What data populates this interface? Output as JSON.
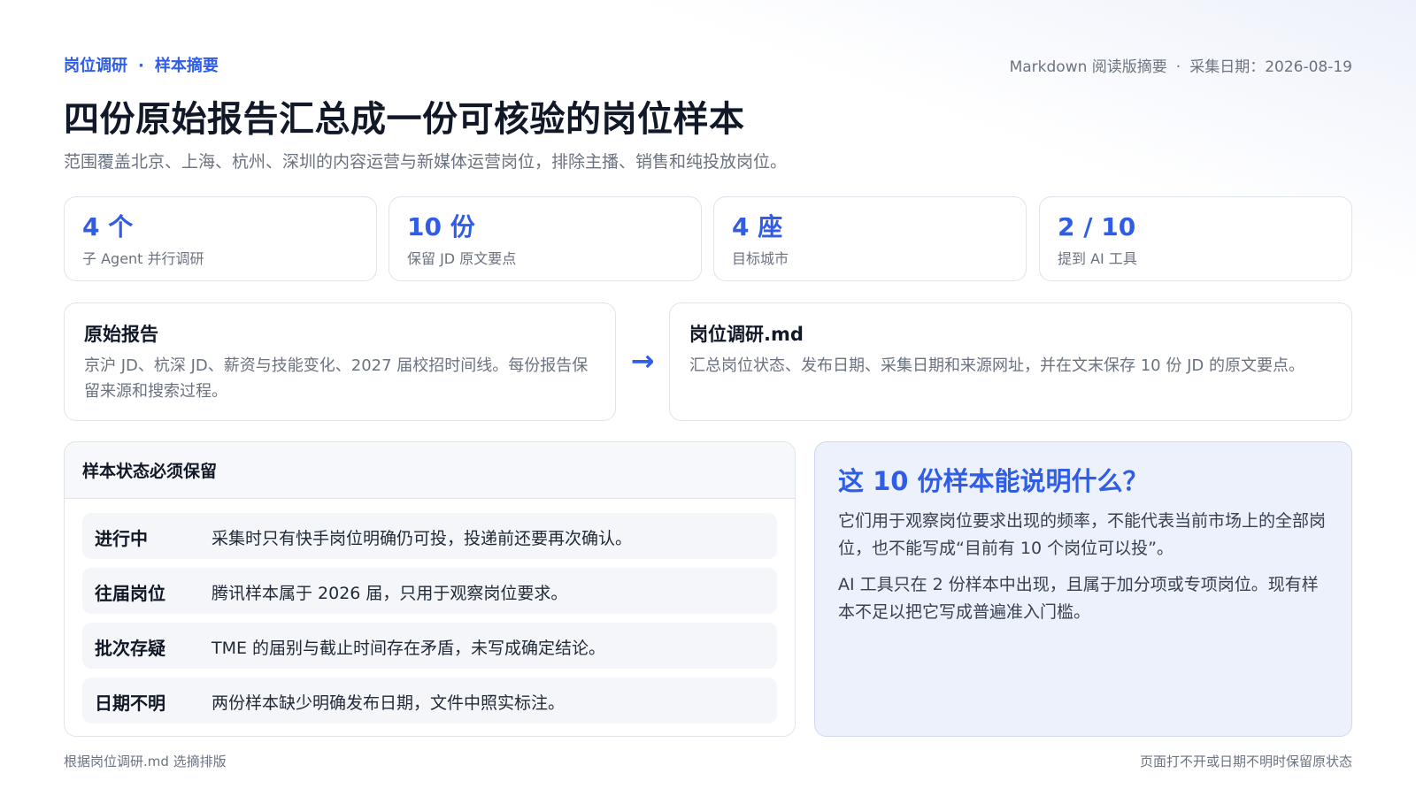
{
  "header": {
    "eyebrow_part1": "岗位调研",
    "eyebrow_sep": "·",
    "eyebrow_part2": "样本摘要",
    "meta_part1": "Markdown 阅读版摘要",
    "meta_sep": "·",
    "meta_part2": "采集日期：2026-08-19",
    "title": "四份原始报告汇总成一份可核验的岗位样本",
    "subtitle": "范围覆盖北京、上海、杭州、深圳的内容运营与新媒体运营岗位，排除主播、销售和纯投放岗位。"
  },
  "stats": [
    {
      "value": "4 个",
      "label": "子 Agent 并行调研"
    },
    {
      "value": "10 份",
      "label": "保留 JD 原文要点"
    },
    {
      "value": "4 座",
      "label": "目标城市"
    },
    {
      "value": "2 / 10",
      "label": "提到 AI 工具"
    }
  ],
  "flow": {
    "source": {
      "title": "原始报告",
      "desc": "京沪 JD、杭深 JD、薪资与技能变化、2027 届校招时间线。每份报告保留来源和搜索过程。"
    },
    "arrow": "→",
    "target": {
      "title": "岗位调研.md",
      "desc": "汇总岗位状态、发布日期、采集日期和来源网址，并在文末保存 10 份 JD 的原文要点。"
    }
  },
  "status": {
    "title": "样本状态必须保留",
    "rows": [
      {
        "key": "进行中",
        "value": "采集时只有快手岗位明确仍可投，投递前还要再次确认。"
      },
      {
        "key": "往届岗位",
        "value": "腾讯样本属于 2026 届，只用于观察岗位要求。"
      },
      {
        "key": "批次存疑",
        "value": "TME 的届别与截止时间存在矛盾，未写成确定结论。"
      },
      {
        "key": "日期不明",
        "value": "两份样本缺少明确发布日期，文件中照实标注。"
      }
    ]
  },
  "explain": {
    "title": "这 10 份样本能说明什么？",
    "p1": "它们用于观察岗位要求出现的频率，不能代表当前市场上的全部岗位，也不能写成“目前有 10 个岗位可以投”。",
    "p2": "AI 工具只在 2 份样本中出现，且属于加分项或专项岗位。现有样本不足以把它写成普遍准入门槛。"
  },
  "footer": {
    "left": "根据岗位调研.md 选摘排版",
    "right": "页面打不开或日期不明时保留原状态"
  },
  "colors": {
    "accent": "#2f5de6",
    "text": "#111827",
    "muted": "#6b7280",
    "panel": "#edf1fc"
  }
}
